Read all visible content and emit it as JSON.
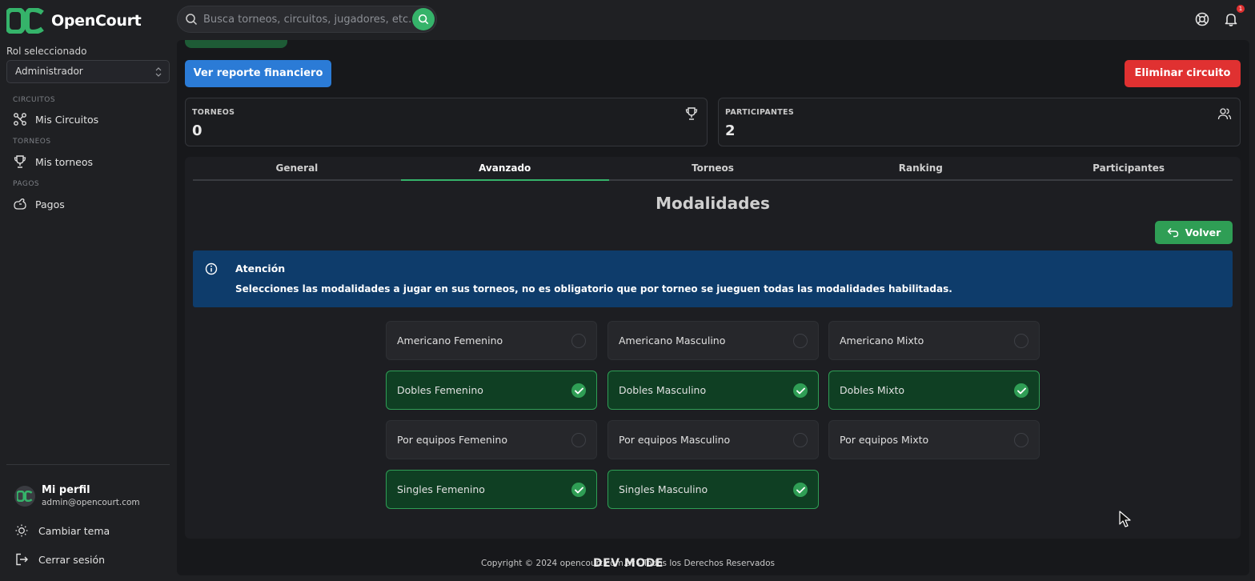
{
  "app": {
    "name": "OpenCourt",
    "brand_color": "#35b36a"
  },
  "search": {
    "placeholder": "Busca torneos, circuitos, jugadores, etc."
  },
  "notifications": {
    "count": "1"
  },
  "sidebar": {
    "role_label": "Rol seleccionado",
    "role_value": "Administrador",
    "sections": [
      {
        "label": "CIRCUITOS",
        "item": {
          "label": "Mis Circuitos",
          "icon": "circuit-icon"
        }
      },
      {
        "label": "TORNEOS",
        "item": {
          "label": "Mis torneos",
          "icon": "trophy-icon"
        }
      },
      {
        "label": "PAGOS",
        "item": {
          "label": "Pagos",
          "icon": "payments-icon"
        }
      }
    ],
    "profile": {
      "name": "Mi perfil",
      "email": "admin@opencourt.com"
    },
    "theme_label": "Cambiar tema",
    "logout_label": "Cerrar sesión"
  },
  "main": {
    "report_button": "Ver reporte financiero",
    "delete_button": "Eliminar circuito",
    "stats": [
      {
        "title": "TORNEOS",
        "value": "0",
        "icon": "trophy-icon"
      },
      {
        "title": "PARTICIPANTES",
        "value": "2",
        "icon": "users-icon"
      }
    ],
    "tabs": [
      "General",
      "Avanzado",
      "Torneos",
      "Ranking",
      "Participantes"
    ],
    "active_tab": "Avanzado",
    "section_title": "Modalidades",
    "back_button": "Volver",
    "alert": {
      "title": "Atención",
      "text": "Selecciones las modalidades a jugar en sus torneos, no es obligatorio que por torneo se jueguen todas las modalidades habilitadas."
    },
    "modalities": [
      {
        "label": "Americano Femenino",
        "checked": false
      },
      {
        "label": "Americano Masculino",
        "checked": false
      },
      {
        "label": "Americano Mixto",
        "checked": false
      },
      {
        "label": "Dobles Femenino",
        "checked": true
      },
      {
        "label": "Dobles Masculino",
        "checked": true
      },
      {
        "label": "Dobles Mixto",
        "checked": true
      },
      {
        "label": "Por equipos Femenino",
        "checked": false
      },
      {
        "label": "Por equipos Masculino",
        "checked": false
      },
      {
        "label": "Por equipos Mixto",
        "checked": false
      },
      {
        "label": "Singles Femenino",
        "checked": true
      },
      {
        "label": "Singles Masculino",
        "checked": true
      }
    ]
  },
  "footer": {
    "text": "Copyright © 2024 opencourt.com.ar - Todos los Derechos Reservados",
    "dev_mode": "DEV MODE"
  }
}
